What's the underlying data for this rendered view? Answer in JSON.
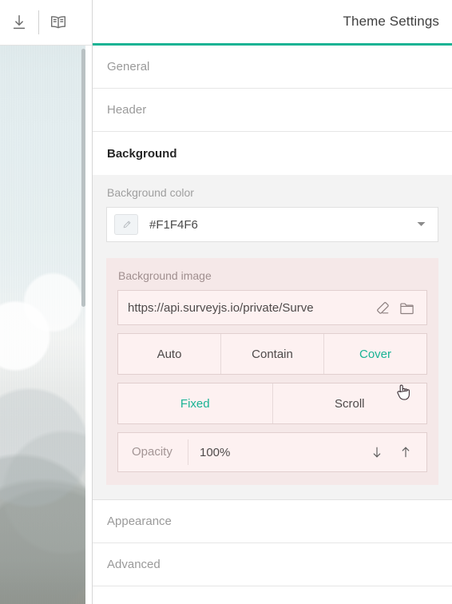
{
  "toolbar": {
    "download_icon": "download-icon",
    "preview_icon": "book-preview-icon"
  },
  "header": {
    "title": "Theme Settings",
    "accent_color": "#19B394"
  },
  "accordion": [
    {
      "label": "General",
      "active": false
    },
    {
      "label": "Header",
      "active": false
    },
    {
      "label": "Background",
      "active": true
    },
    {
      "label": "Appearance",
      "active": false
    },
    {
      "label": "Advanced",
      "active": false
    }
  ],
  "background_panel": {
    "color": {
      "label": "Background color",
      "value": "#F1F4F6",
      "swatch_color": "#F1F4F6",
      "dropdown_icon": "chevron-down-icon"
    },
    "image": {
      "label": "Background image",
      "url": "https://api.surveyjs.io/private/Surve",
      "clear_icon": "eraser-icon",
      "browse_icon": "folder-icon",
      "highlight_color": "#F5E8E8"
    },
    "fit_options": [
      {
        "label": "Auto",
        "selected": false
      },
      {
        "label": "Contain",
        "selected": false
      },
      {
        "label": "Cover",
        "selected": true
      }
    ],
    "attachment_options": [
      {
        "label": "Fixed",
        "selected": true
      },
      {
        "label": "Scroll",
        "selected": false
      }
    ],
    "opacity": {
      "label": "Opacity",
      "value": "100%",
      "decrement_icon": "arrow-down-icon",
      "increment_icon": "arrow-up-icon"
    }
  },
  "preview": {
    "scrollbar": "vertical-scrollbar"
  },
  "cursor": {
    "type": "pointer-hand-cursor"
  }
}
